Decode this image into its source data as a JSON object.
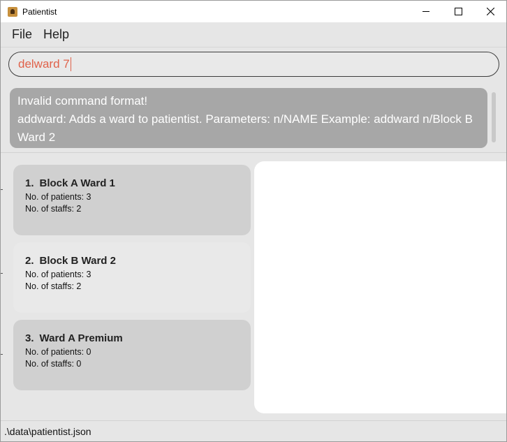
{
  "window": {
    "title": "Patientist",
    "app_icon": "patientist-app-icon",
    "controls": [
      "minimize-icon",
      "maximize-icon",
      "close-icon"
    ]
  },
  "menu": {
    "items": [
      {
        "label": "File"
      },
      {
        "label": "Help"
      }
    ]
  },
  "command": {
    "value": "delward 7",
    "text_color": "#e0624a"
  },
  "result": {
    "line1": "Invalid command format!",
    "line2": "addward: Adds a ward to patientist. Parameters: n/NAME Example: addward n/Block B Ward 2"
  },
  "wards": [
    {
      "index": "1.",
      "name": "Block A Ward 1",
      "patients": "No. of patients: 3",
      "staffs": "No. of staffs: 2"
    },
    {
      "index": "2.",
      "name": "Block B Ward 2",
      "patients": "No. of patients: 3",
      "staffs": "No. of staffs: 2"
    },
    {
      "index": "3.",
      "name": "Ward A Premium",
      "patients": "No. of patients: 0",
      "staffs": "No. of staffs: 0"
    }
  ],
  "status": {
    "path": ".\\data\\patientist.json"
  },
  "colors": {
    "result_bg": "#a7a7a7",
    "card_bg": "#d0d0d0",
    "card_selected_bg": "#e9e9e9",
    "detail_bg": "#ffffff"
  }
}
